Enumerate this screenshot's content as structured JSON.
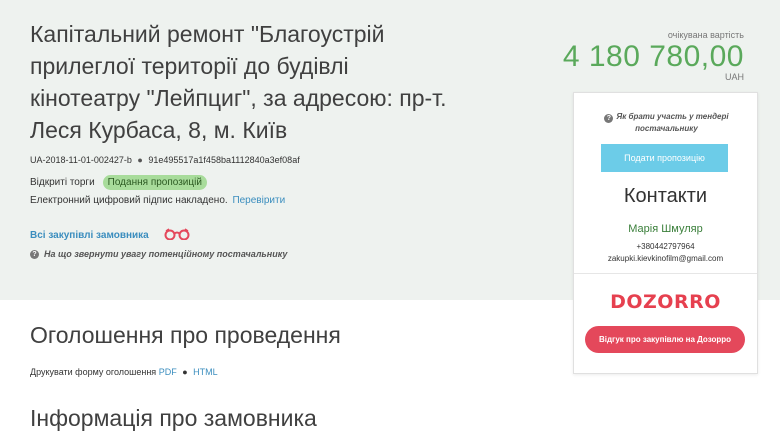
{
  "tender": {
    "title": "Капітальний ремонт \"Благоустрій прилеглої території до будівлі кінотеатру \"Лейпциг\", за адресою: пр-т. Леся Курбаса, 8, м. Київ",
    "id": "UA-2018-11-01-002427-b",
    "id_separator": "●",
    "hash": "91e495517a1f458ba1112840a3ef08af",
    "procedure_type": "Відкриті торги",
    "status": "Подання пропозицій",
    "signature_text": "Електронний цифровий підпис накладено.",
    "verify_link": "Перевірити",
    "all_purchases_link": "Всі закупівлі замовника",
    "attention_text": "На що звернути увагу потенційному постачальнику"
  },
  "expected": {
    "label": "очікувана вартість",
    "value": "4 180 780,00",
    "currency": "UAH"
  },
  "sidebar": {
    "how_to_participate": "Як брати участь у тендері постачальнику",
    "submit_button": "Подати пропозицію",
    "contacts_title": "Контакти",
    "contact_name": "Марія Шмуляр",
    "contact_phone": "+380442797964",
    "contact_email": "zakupki.kievkinofilm@gmail.com",
    "dozorro_logo": "DOZORRO",
    "review_button": "Відгук про закупівлю на Дозорро"
  },
  "main": {
    "announcement_title": "Оголошення про проведення",
    "print_text": "Друкувати форму оголошення",
    "pdf_link": "PDF",
    "dot": "●",
    "html_link": "HTML",
    "customer_title": "Інформація про замовника"
  },
  "colors": {
    "accent_green": "#5aa95b",
    "link_blue": "#3a8dbe",
    "dozorro_red": "#e4485b",
    "submit_blue": "#6ccce8",
    "header_bg": "#eef2ef"
  },
  "icons": {
    "question": "question-circle-icon",
    "glasses": "binoculars-icon"
  }
}
